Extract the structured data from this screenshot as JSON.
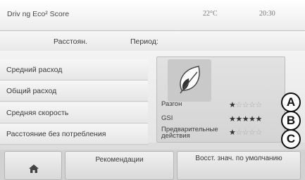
{
  "header": {
    "title": "Driv ng Eco² Score",
    "temperature": "22°C",
    "time": "20:30"
  },
  "tabs": [
    {
      "label": "Расстоян."
    },
    {
      "label": "Период:"
    }
  ],
  "list": [
    {
      "label": "Средний расход"
    },
    {
      "label": "Общий расход"
    },
    {
      "label": "Средняя скорость"
    },
    {
      "label": "Расстояние без потребления"
    }
  ],
  "scores": [
    {
      "label": "Разгон",
      "stars": "★☆☆☆☆",
      "rating": 1,
      "max": 5,
      "callout": "A"
    },
    {
      "label": "GSI",
      "stars": "★★★★★",
      "rating": 5,
      "max": 5,
      "callout": "B"
    },
    {
      "label": "Предварительные действия",
      "stars": "★☆☆☆☆",
      "rating": 1,
      "max": 5,
      "callout": "C"
    }
  ],
  "buttons": {
    "home_icon": "home-icon",
    "recommendations": "Рекомендации",
    "reset": "Восст. знач. по умолчанию"
  },
  "icons": {
    "eco": "leaf-icon",
    "home": "home-icon"
  }
}
